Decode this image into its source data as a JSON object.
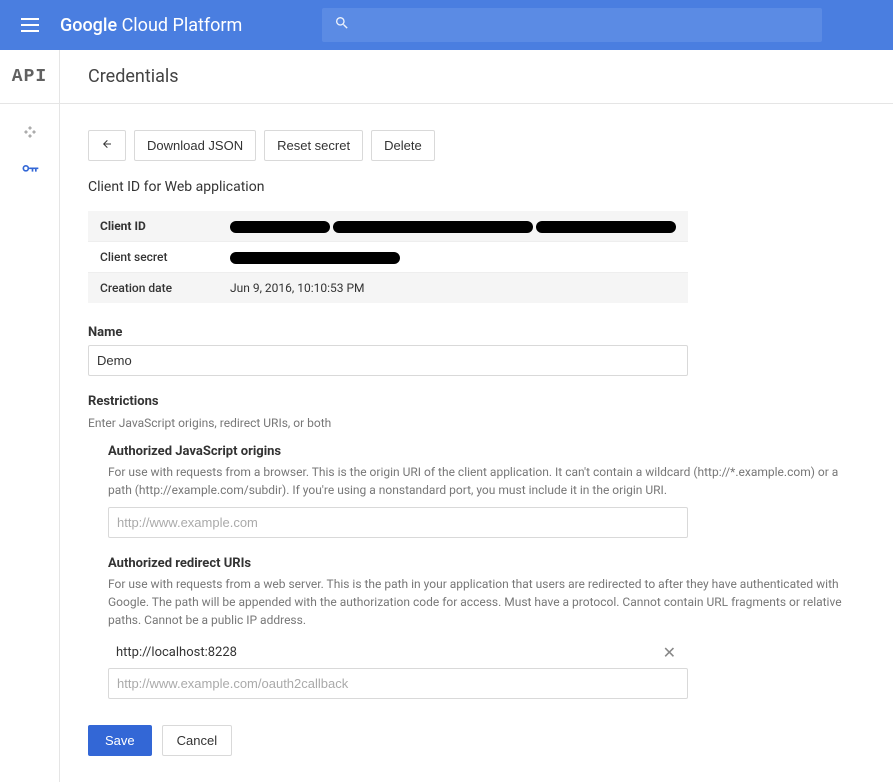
{
  "topbar": {
    "brand_prefix": "Google ",
    "brand_suffix": "Cloud Platform",
    "search_placeholder": ""
  },
  "header": {
    "product_abbrev": "API",
    "title": "Credentials"
  },
  "toolbar": {
    "download_json": "Download JSON",
    "reset_secret": "Reset secret",
    "delete": "Delete"
  },
  "section": {
    "client_id_heading": "Client ID for Web application"
  },
  "info": {
    "client_id_label": "Client ID",
    "client_secret_label": "Client secret",
    "creation_date_label": "Creation date",
    "creation_date_value": "Jun 9, 2016, 10:10:53 PM"
  },
  "form": {
    "name_label": "Name",
    "name_value": "Demo",
    "restrictions_label": "Restrictions",
    "restrictions_help": "Enter JavaScript origins, redirect URIs, or both",
    "js_origins_label": "Authorized JavaScript origins",
    "js_origins_help": "For use with requests from a browser. This is the origin URI of the client application. It can't contain a wildcard (http://*.example.com) or a path (http://example.com/subdir). If you're using a nonstandard port, you must include it in the origin URI.",
    "js_origins_placeholder": "http://www.example.com",
    "redirect_label": "Authorized redirect URIs",
    "redirect_help": "For use with requests from a web server. This is the path in your application that users are redirected to after they have authenticated with Google. The path will be appended with the authorization code for access. Must have a protocol. Cannot contain URL fragments or relative paths. Cannot be a public IP address.",
    "redirect_entries": [
      "http://localhost:8228"
    ],
    "redirect_placeholder": "http://www.example.com/oauth2callback"
  },
  "footer": {
    "save": "Save",
    "cancel": "Cancel"
  }
}
